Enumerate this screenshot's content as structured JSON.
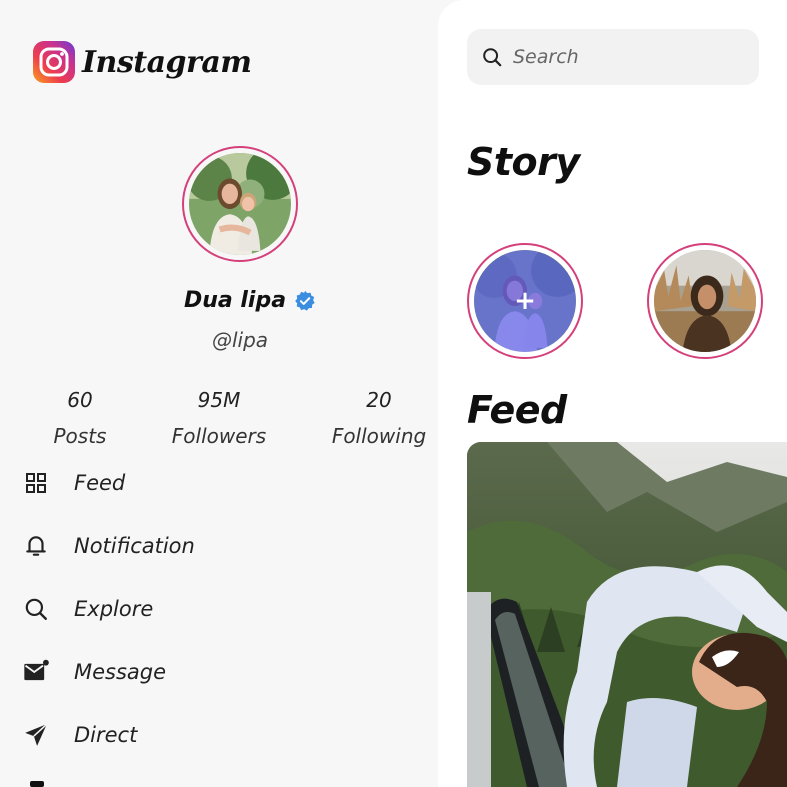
{
  "app": {
    "name": "Instagram"
  },
  "profile": {
    "name": "Dua lipa",
    "handle": "@lipa",
    "verified": true,
    "stats": {
      "posts": {
        "value": "60",
        "label": "Posts"
      },
      "followers": {
        "value": "95M",
        "label": "Followers"
      },
      "following": {
        "value": "20",
        "label": "Following"
      }
    }
  },
  "nav": {
    "items": [
      {
        "label": "Feed",
        "icon": "grid-icon"
      },
      {
        "label": "Notification",
        "icon": "bell-icon"
      },
      {
        "label": "Explore",
        "icon": "search-icon"
      },
      {
        "label": "Message",
        "icon": "mail-icon"
      },
      {
        "label": "Direct",
        "icon": "send-icon"
      }
    ]
  },
  "search": {
    "placeholder": "Search",
    "value": ""
  },
  "story": {
    "title": "Story",
    "add_label": "+"
  },
  "feed": {
    "title": "Feed"
  },
  "colors": {
    "ring": "#d4407a",
    "verified": "#3b8de0",
    "add_overlay": "#5f5ff0",
    "sidebar_bg": "#f7f7f7",
    "panel_bg": "#ffffff"
  }
}
